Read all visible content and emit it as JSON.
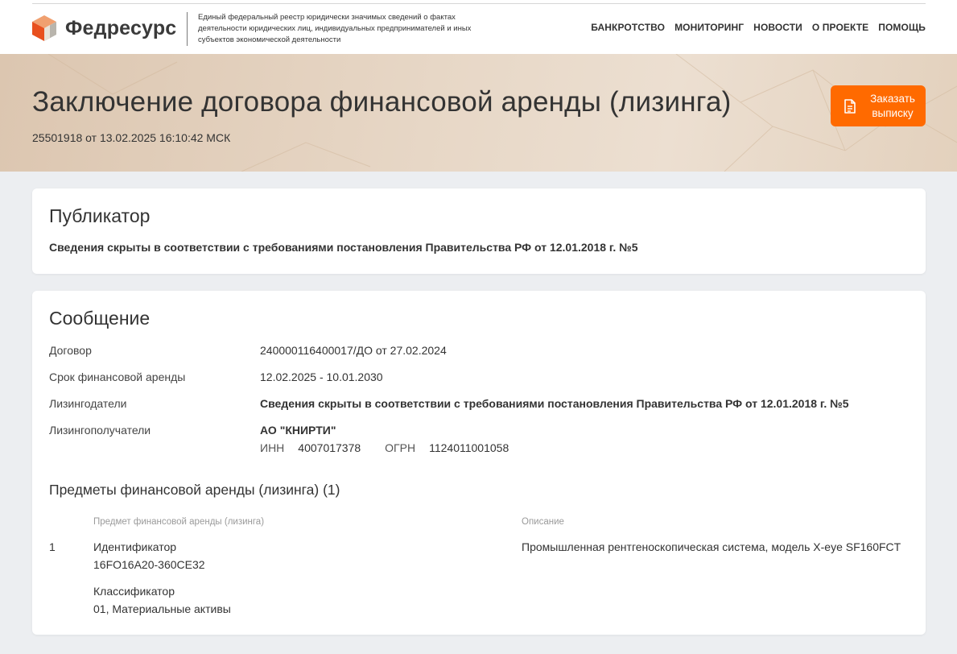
{
  "header": {
    "brand": "Федресурс",
    "tagline": "Единый федеральный реестр юридически значимых сведений о фактах деятельности юридических лиц, индивидуальных предпринимателей и иных субъектов экономической деятельности",
    "nav": [
      "БАНКРОТСТВО",
      "МОНИТОРИНГ",
      "НОВОСТИ",
      "О ПРОЕКТЕ",
      "ПОМОЩЬ"
    ]
  },
  "hero": {
    "title": "Заключение договора финансовой аренды (лизинга)",
    "subtitle": "25501918 от 13.02.2025 16:10:42 МСК",
    "order_button": "Заказать выписку"
  },
  "publisher": {
    "title": "Публикатор",
    "text": "Сведения скрыты в соответствии с требованиями постановления Правительства РФ от 12.01.2018 г. №5"
  },
  "message": {
    "title": "Сообщение",
    "rows": [
      {
        "label": "Договор",
        "value": "240000116400017/ДО от 27.02.2024"
      },
      {
        "label": "Срок финансовой аренды",
        "value": "12.02.2025 - 10.01.2030"
      },
      {
        "label": "Лизингодатели",
        "value": "Сведения скрыты в соответствии с требованиями постановления Правительства РФ от 12.01.2018 г. №5"
      },
      {
        "label": "Лизингополучатели",
        "value": "АО \"КНИРТИ\""
      }
    ],
    "inn_label": "ИНН",
    "inn": "4007017378",
    "ogrn_label": "ОГРН",
    "ogrn": "1124011001058",
    "subjects_title": "Предметы финансовой аренды (лизинга) (1)",
    "table": {
      "col_subject": "Предмет финансовой аренды (лизинга)",
      "col_description": "Описание",
      "rows": [
        {
          "num": "1",
          "id_label": "Идентификатор",
          "id_value": "16FO16A20-360CE32",
          "class_label": "Классификатор",
          "class_value": "01, Материальные активы",
          "description": "Промышленная рентгеноскопическая система, модель X-eye SF160FCT"
        }
      ]
    }
  },
  "colors": {
    "accent": "#ff6a00",
    "page_bg": "#eceef1",
    "hero_bg": "#e7d7c6"
  }
}
